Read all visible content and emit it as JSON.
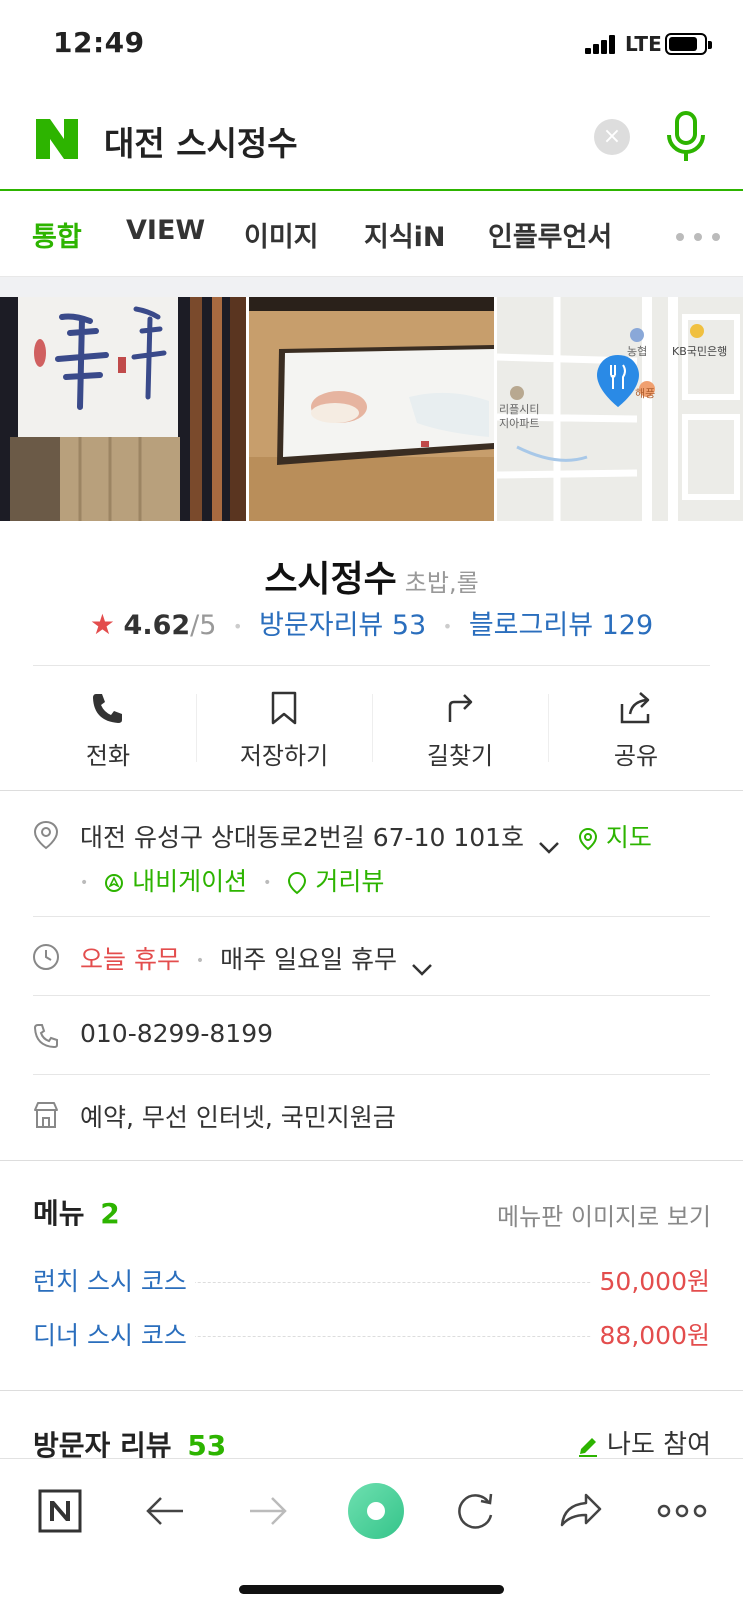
{
  "status_bar": {
    "time": "12:49",
    "network": "LTE"
  },
  "search": {
    "query": "대전 스시정수",
    "clear_label": "×"
  },
  "tabs": [
    "통합",
    "VIEW",
    "이미지",
    "지식iN",
    "인플루언서"
  ],
  "place": {
    "name": "스시정수",
    "category": "초밥,롤",
    "rating": "4.62",
    "rating_max": "/5",
    "visitor_reviews": "방문자리뷰 53",
    "blog_reviews": "블로그리뷰 129"
  },
  "photo_texts": {
    "map_label_bank": "KB국민은행",
    "map_label_nh": "농협",
    "map_label_apt1": "리플시티",
    "map_label_apt2": "지아파트",
    "map_label_store": "해풍"
  },
  "actions": {
    "call": "전화",
    "save": "저장하기",
    "directions": "길찾기",
    "share": "공유"
  },
  "info": {
    "address": "대전 유성구 상대동로2번길 67-10 101호",
    "map_link": "지도",
    "navigation_link": "내비게이션",
    "street_view_link": "거리뷰",
    "closed_today": "오늘 휴무",
    "hours_detail": "매주 일요일 휴무",
    "phone": "010-8299-8199",
    "amenities": "예약, 무선 인터넷, 국민지원금"
  },
  "menu": {
    "title": "메뉴",
    "count": "2",
    "image_link": "메뉴판 이미지로 보기",
    "items": [
      {
        "name": "런치 스시 코스",
        "price": "50,000원"
      },
      {
        "name": "디너 스시 코스",
        "price": "88,000원"
      }
    ]
  },
  "reviews": {
    "title": "방문자 리뷰",
    "count": "53",
    "join_label": "나도 참여"
  },
  "colors": {
    "naver_green": "#2db400",
    "link_blue": "#2a6ebd",
    "price_red": "#e34d4d",
    "pin_blue": "#2a8ae6"
  }
}
